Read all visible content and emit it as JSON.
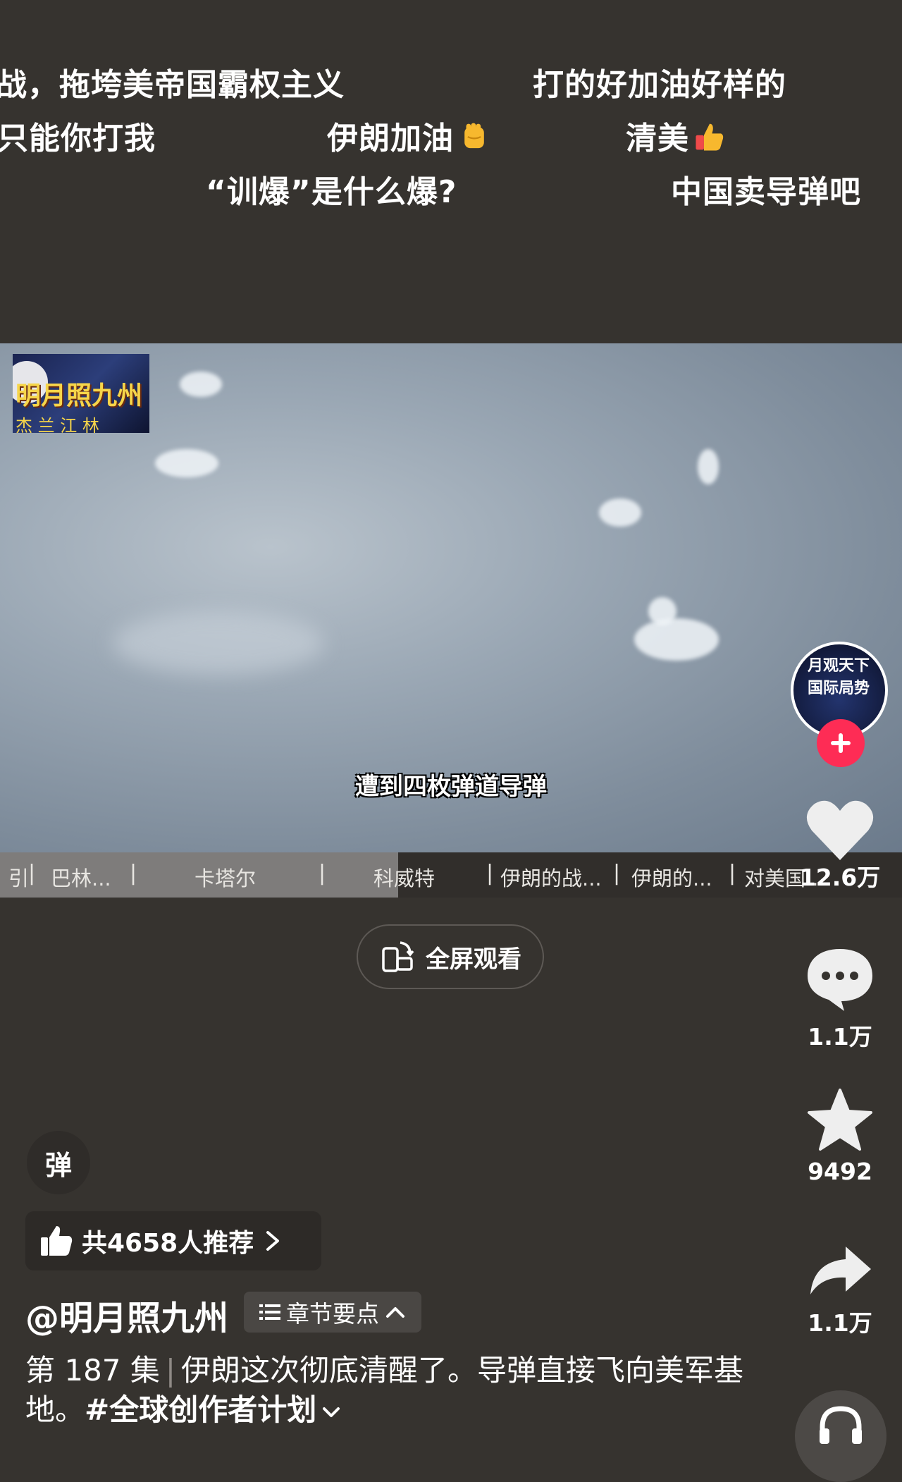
{
  "danmaku": [
    "战，拖垮美帝国霸权主义",
    "打的好加油好样的",
    "只能你打我",
    "伊朗加油",
    "清美",
    "“训爆”是什么爆?",
    "中国卖导弹吧"
  ],
  "video": {
    "channel_logo_text": "明月照九州",
    "channel_logo_sub": "杰 兰 江 林",
    "subtitle": "遭到四枚弹道导弹"
  },
  "chapters": [
    "引",
    "巴林...",
    "卡塔尔",
    "科威特",
    "伊朗的战...",
    "伊朗的...",
    "对美国..."
  ],
  "fullscreen_label": "全屏观看",
  "sidebar": {
    "avatar_text_line1": "月观天下",
    "avatar_text_line2": "国际局势",
    "likes": "12.6万",
    "comments": "1.1万",
    "favorites": "9492",
    "shares": "1.1万"
  },
  "danmu_toggle_label": "弹",
  "recommend_label": "共4658人推荐",
  "author": "@明月照九州",
  "chapter_tag_label": "章节要点",
  "description": {
    "episode": "第 187 集",
    "text": "伊朗这次彻底清醒了。导弹直接飞向美军基地。",
    "hashtag": "#全球创作者计划"
  },
  "colors": {
    "background": "#36332f",
    "follow_red": "#fe2c55"
  }
}
